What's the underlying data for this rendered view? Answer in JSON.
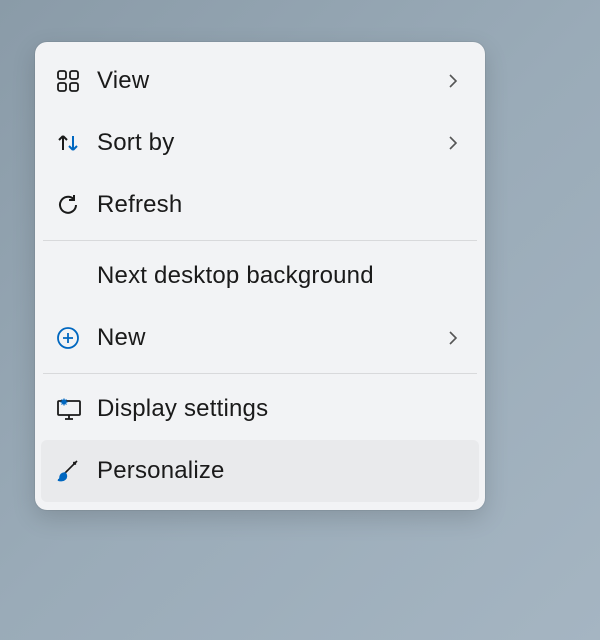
{
  "menu": {
    "items": [
      {
        "label": "View",
        "has_submenu": true
      },
      {
        "label": "Sort by",
        "has_submenu": true
      },
      {
        "label": "Refresh",
        "has_submenu": false
      },
      {
        "label": "Next desktop background",
        "has_submenu": false
      },
      {
        "label": "New",
        "has_submenu": true
      },
      {
        "label": "Display settings",
        "has_submenu": false
      },
      {
        "label": "Personalize",
        "has_submenu": false
      }
    ]
  },
  "colors": {
    "accent": "#0067C0",
    "text": "#1a1a1a",
    "menu_bg": "#f2f3f5",
    "hover_bg": "#e9eaec"
  }
}
